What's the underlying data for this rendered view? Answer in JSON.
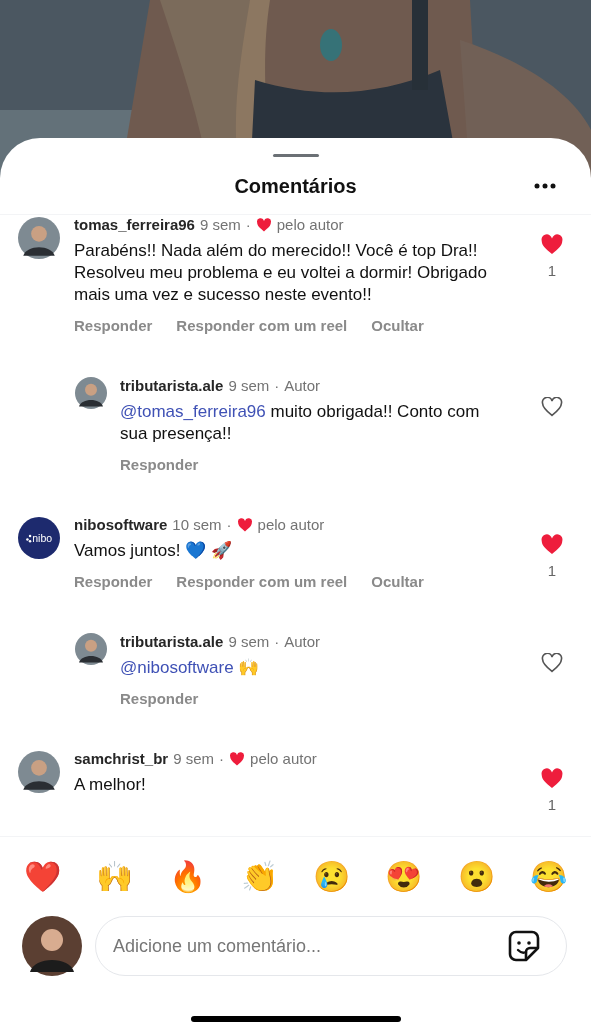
{
  "sheet": {
    "title": "Comentários"
  },
  "comments": [
    {
      "username": "tomas_ferreira96",
      "time": "9 sem",
      "separator": "·",
      "tag": "pelo autor",
      "tag_heart": true,
      "avatar": {
        "kind": "person"
      },
      "text": "Parabéns!! Nada além do merecido!! Você é top Dra!! Resolveu meu problema e eu voltei a dormir! Obrigado mais uma vez e sucesso neste evento!!",
      "liked": true,
      "like_count": "1",
      "actions": [
        "Responder",
        "Responder com um reel",
        "Ocultar"
      ],
      "replies": [
        {
          "username": "tributarista.ale",
          "time": "9 sem",
          "separator": "·",
          "tag": "Autor",
          "tag_heart": false,
          "mention": "@tomas_ferreira96",
          "text": " muito obrigada!! Conto com sua presença!!",
          "liked": false,
          "actions": [
            "Responder"
          ]
        }
      ]
    },
    {
      "username": "nibosoftware",
      "time": "10 sem",
      "separator": "·",
      "tag": "pelo autor",
      "tag_heart": true,
      "avatar": {
        "kind": "logo",
        "text": "nibo"
      },
      "text": "Vamos juntos! 💙 🚀",
      "liked": true,
      "like_count": "1",
      "actions": [
        "Responder",
        "Responder com um reel",
        "Ocultar"
      ],
      "replies": [
        {
          "username": "tributarista.ale",
          "time": "9 sem",
          "separator": "·",
          "tag": "Autor",
          "tag_heart": false,
          "mention": "@nibosoftware",
          "text": " 🙌",
          "liked": false,
          "actions": [
            "Responder"
          ]
        }
      ]
    },
    {
      "username": "samchrist_br",
      "time": "9 sem",
      "separator": "·",
      "tag": "pelo autor",
      "tag_heart": true,
      "avatar": {
        "kind": "person"
      },
      "text": "A melhor!",
      "liked": true,
      "like_count": "1"
    }
  ],
  "reactions": [
    "❤️",
    "🙌",
    "🔥",
    "👏",
    "😢",
    "😍",
    "😮",
    "😂"
  ],
  "comment_input": {
    "placeholder": "Adicione um comentário..."
  }
}
